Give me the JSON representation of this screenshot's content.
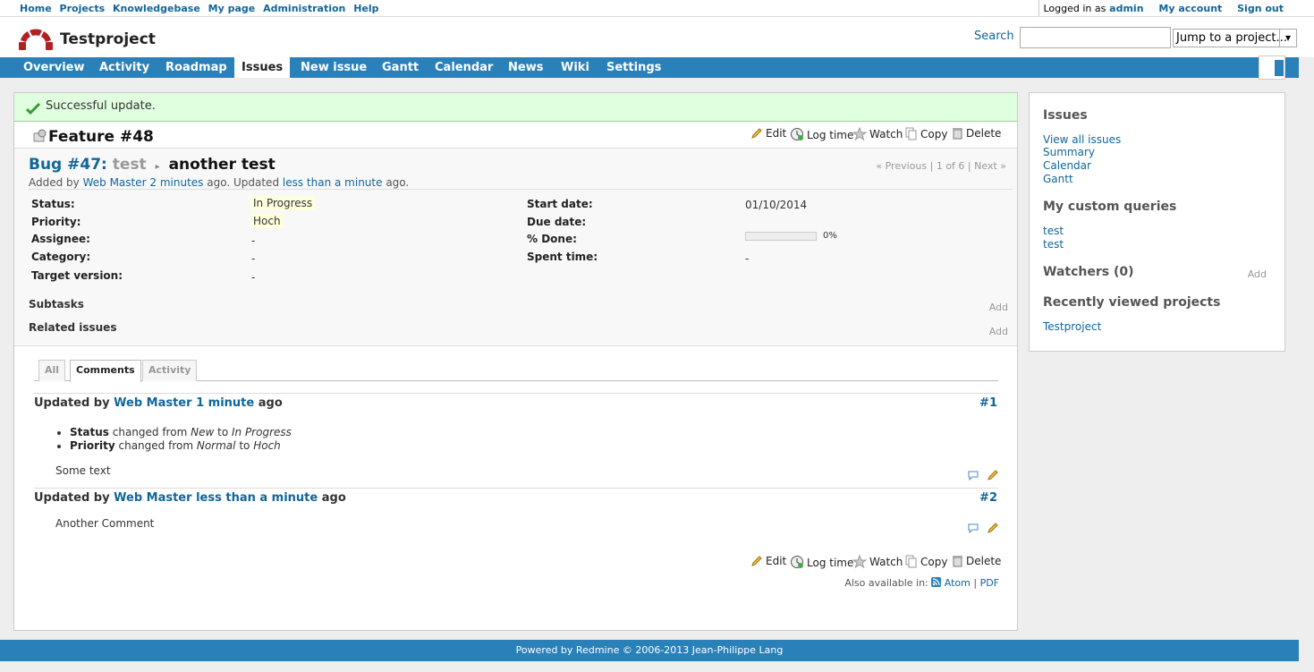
{
  "top_menu": {
    "items": [
      "Home",
      "Projects",
      "Knowledgebase",
      "My page",
      "Administration",
      "Help"
    ],
    "logged_in_prefix": "Logged in as",
    "user": "admin",
    "my_account": "My account",
    "sign_out": "Sign out"
  },
  "header": {
    "project_title": "Testproject",
    "search_label": "Search",
    "search_value": "",
    "jump_label": "Jump to a project..."
  },
  "main_menu": {
    "items": [
      "Overview",
      "Activity",
      "Roadmap",
      "Issues",
      "New issue",
      "Gantt",
      "Calendar",
      "News",
      "Wiki",
      "Settings"
    ],
    "selected": "Issues"
  },
  "flash": "Successful update.",
  "issue": {
    "title": "Feature #48",
    "actions": {
      "edit": "Edit",
      "log_time": "Log time",
      "watch": "Watch",
      "copy": "Copy",
      "delete": "Delete"
    },
    "parent_link": "Bug #47:",
    "parent_title": "test",
    "subject": "another test",
    "prev": "« Previous",
    "count": "1 of 6",
    "next": "Next »",
    "sep": "|",
    "added_by": "Added by",
    "author": "Web Master",
    "created_ago": "2 minutes",
    "ago_updated": "ago. Updated",
    "updated_ago": "less than a minute",
    "ago_end": "ago.",
    "attributes": {
      "status_label": "Status:",
      "status": "In Progress",
      "priority_label": "Priority:",
      "priority": "Hoch",
      "assignee_label": "Assignee:",
      "assignee": "-",
      "category_label": "Category:",
      "category": "-",
      "target_label": "Target version:",
      "target": "-",
      "start_label": "Start date:",
      "start": "01/10/2014",
      "due_label": "Due date:",
      "due": "",
      "done_label": "% Done:",
      "done": "0%",
      "done_fraction": 0,
      "spent_label": "Spent time:",
      "spent": "-"
    },
    "subtasks": "Subtasks",
    "related": "Related issues",
    "add": "Add"
  },
  "tabs": [
    "All",
    "Comments",
    "Activity"
  ],
  "journals": [
    {
      "prefix": "Updated by",
      "author": "Web Master",
      "time": "1 minute",
      "suffix": "ago",
      "num": "#1",
      "details": [
        {
          "field": "Status",
          "text": "changed from",
          "old": "New",
          "to": "to",
          "new": "In Progress"
        },
        {
          "field": "Priority",
          "text": "changed from",
          "old": "Normal",
          "to": "to",
          "new": "Hoch"
        }
      ],
      "note": "Some text"
    },
    {
      "prefix": "Updated by",
      "author": "Web Master",
      "time": "less than a minute",
      "suffix": "ago",
      "num": "#2",
      "note": "Another Comment"
    }
  ],
  "other_formats": {
    "label": "Also available in:",
    "atom": "Atom",
    "sep": "|",
    "pdf": "PDF"
  },
  "sidebar": {
    "issues_heading": "Issues",
    "issues_links": [
      "View all issues",
      "Summary",
      "Calendar",
      "Gantt"
    ],
    "custom_heading": "My custom queries",
    "custom_links": [
      "test",
      "test"
    ],
    "watchers_heading": "Watchers (0)",
    "watchers_add": "Add",
    "recent_heading": "Recently viewed projects",
    "recent_links": [
      "Testproject"
    ]
  },
  "footer": "Powered by Redmine © 2006-2013 Jean-Philippe Lang",
  "colors": {
    "accent": "#2a80b9",
    "link": "#169",
    "flash_bg": "#dfffdf",
    "highlight": "#ffffdd"
  }
}
